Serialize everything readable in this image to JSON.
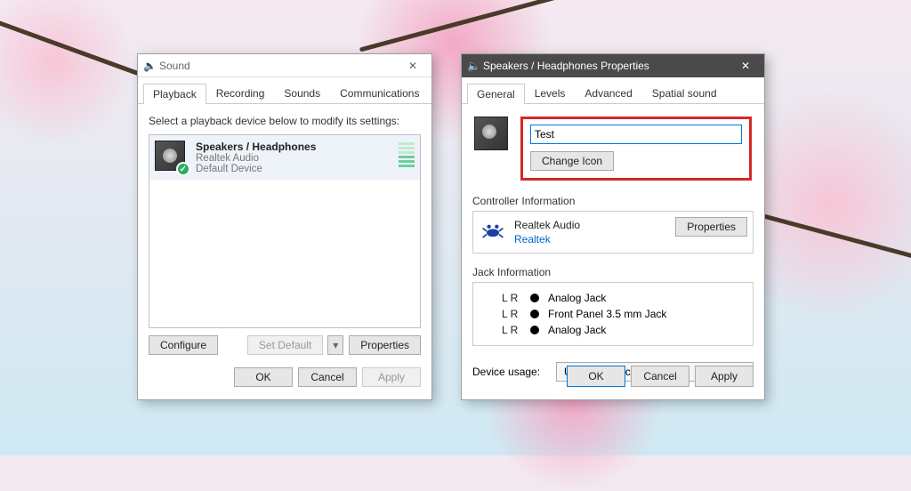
{
  "sound_window": {
    "title": "Sound",
    "tabs": [
      "Playback",
      "Recording",
      "Sounds",
      "Communications"
    ],
    "active_tab": 0,
    "instruction": "Select a playback device below to modify its settings:",
    "device": {
      "name": "Speakers / Headphones",
      "driver": "Realtek Audio",
      "status": "Default Device"
    },
    "buttons": {
      "configure": "Configure",
      "set_default": "Set Default",
      "properties": "Properties",
      "ok": "OK",
      "cancel": "Cancel",
      "apply": "Apply"
    }
  },
  "props_window": {
    "title": "Speakers / Headphones Properties",
    "tabs": [
      "General",
      "Levels",
      "Advanced",
      "Spatial sound"
    ],
    "active_tab": 0,
    "name_value": "Test",
    "change_icon": "Change Icon",
    "controller_section": "Controller Information",
    "controller": {
      "name": "Realtek Audio",
      "vendor": "Realtek",
      "properties": "Properties"
    },
    "jack_section": "Jack Information",
    "jacks": [
      {
        "lr": "L R",
        "label": "Analog Jack"
      },
      {
        "lr": "L R",
        "label": "Front Panel 3.5 mm Jack"
      },
      {
        "lr": "L R",
        "label": "Analog Jack"
      }
    ],
    "usage_label": "Device usage:",
    "usage_value": "Use this device (enable)",
    "buttons": {
      "ok": "OK",
      "cancel": "Cancel",
      "apply": "Apply"
    }
  }
}
